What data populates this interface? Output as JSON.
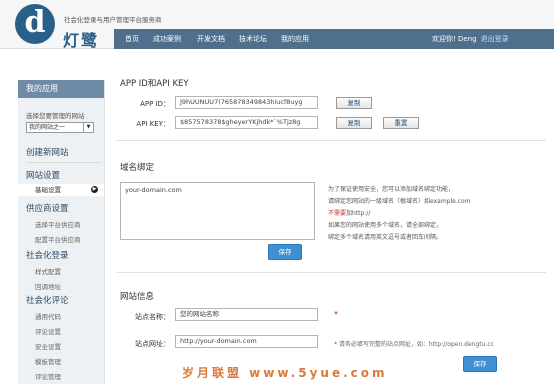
{
  "header": {
    "logo_letter": "d",
    "brand": "灯鹭",
    "tagline": "社会化登录与用户管理平台服务商",
    "nav": [
      "首页",
      "成功案例",
      "开发文档",
      "技术论坛",
      "我的应用"
    ],
    "welcome": "欢迎你! Deng",
    "logout": "退出登录"
  },
  "sidebar": {
    "title": "我的应用",
    "select_hint": "选择您要管理的网站",
    "select_value": "我的网站之一",
    "create_site": "创建新网站",
    "sections": [
      {
        "title": "网站设置",
        "items": [
          "基础设置"
        ]
      },
      {
        "title": "供应商设置",
        "items": [
          "选择平台供应商",
          "配置平台供应商"
        ]
      },
      {
        "title": "社会化登录",
        "items": [
          "样式配置",
          "回调地址"
        ]
      },
      {
        "title": "社会化评论",
        "items": [
          "通用代码",
          "评论设置",
          "安全设置",
          "模板管理",
          "评论管理"
        ]
      }
    ]
  },
  "app_section": {
    "title": "APP ID和API KEY",
    "app_id_label": "APP ID：",
    "app_id_value": "J9hUUNUU7(765878349843hiucf8uyg",
    "api_key_label": "API KEY：",
    "api_key_value": "$857578378$gheyerYKjhdk*`%Tjz8g",
    "copy_label": "复制",
    "reset_label": "重置"
  },
  "domain_section": {
    "title": "域名绑定",
    "textarea_value": "your-domain.com",
    "save_label": "保存",
    "help_lines": [
      "为了保证使用安全，您可以添加域名绑定功能，",
      "请绑定您网站的一级域名（根域名）如example.com",
      "不需要加http://",
      "如果您的网站使用多个域名，请全部绑定，",
      "绑定多个域名请用英文逗号或者回车间隔。"
    ],
    "help_red_prefix": "不需要",
    "help_red_rest": "加http://"
  },
  "site_section": {
    "title": "网站信息",
    "name_label": "站点名称：",
    "name_value": "您的网站名称",
    "url_label": "站点网址：",
    "url_value": "http://your-domain.com",
    "required_mark": "*",
    "url_note": "* 请务必填写完整的站点网址，如：http://open.dengtu.cc",
    "save_label": "保存"
  },
  "watermark": "岁月联盟 www.5yue.com"
}
